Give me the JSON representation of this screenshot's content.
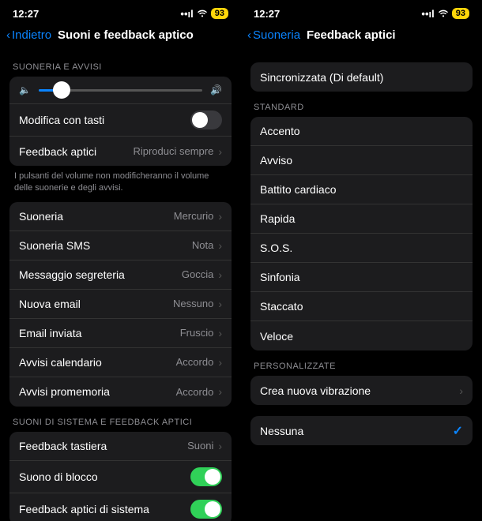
{
  "status": {
    "time": "12:27",
    "battery": "93"
  },
  "left": {
    "back": "Indietro",
    "title": "Suoni e feedback aptico",
    "h1": "SUONERIA E AVVISI",
    "modify": "Modifica con tasti",
    "haptic": "Feedback aptici",
    "haptic_val": "Riproduci sempre",
    "footer": "I pulsanti del volume non modificheranno il volume delle suonerie e degli avvisi.",
    "r1l": "Suoneria",
    "r1v": "Mercurio",
    "r2l": "Suoneria SMS",
    "r2v": "Nota",
    "r3l": "Messaggio segreteria",
    "r3v": "Goccia",
    "r4l": "Nuova email",
    "r4v": "Nessuno",
    "r5l": "Email inviata",
    "r5v": "Fruscio",
    "r6l": "Avvisi calendario",
    "r6v": "Accordo",
    "r7l": "Avvisi promemoria",
    "r7v": "Accordo",
    "h2": "SUONI DI SISTEMA E FEEDBACK APTICI",
    "s1l": "Feedback tastiera",
    "s1v": "Suoni",
    "s2l": "Suono di blocco",
    "s3l": "Feedback aptici di sistema"
  },
  "right": {
    "back": "Suoneria",
    "title": "Feedback aptici",
    "sync": "Sincronizzata (Di default)",
    "h1": "STANDARD",
    "o1": "Accento",
    "o2": "Avviso",
    "o3": "Battito cardiaco",
    "o4": "Rapida",
    "o5": "S.O.S.",
    "o6": "Sinfonia",
    "o7": "Staccato",
    "o8": "Veloce",
    "h2": "PERSONALIZZATE",
    "create": "Crea nuova vibrazione",
    "none": "Nessuna"
  }
}
